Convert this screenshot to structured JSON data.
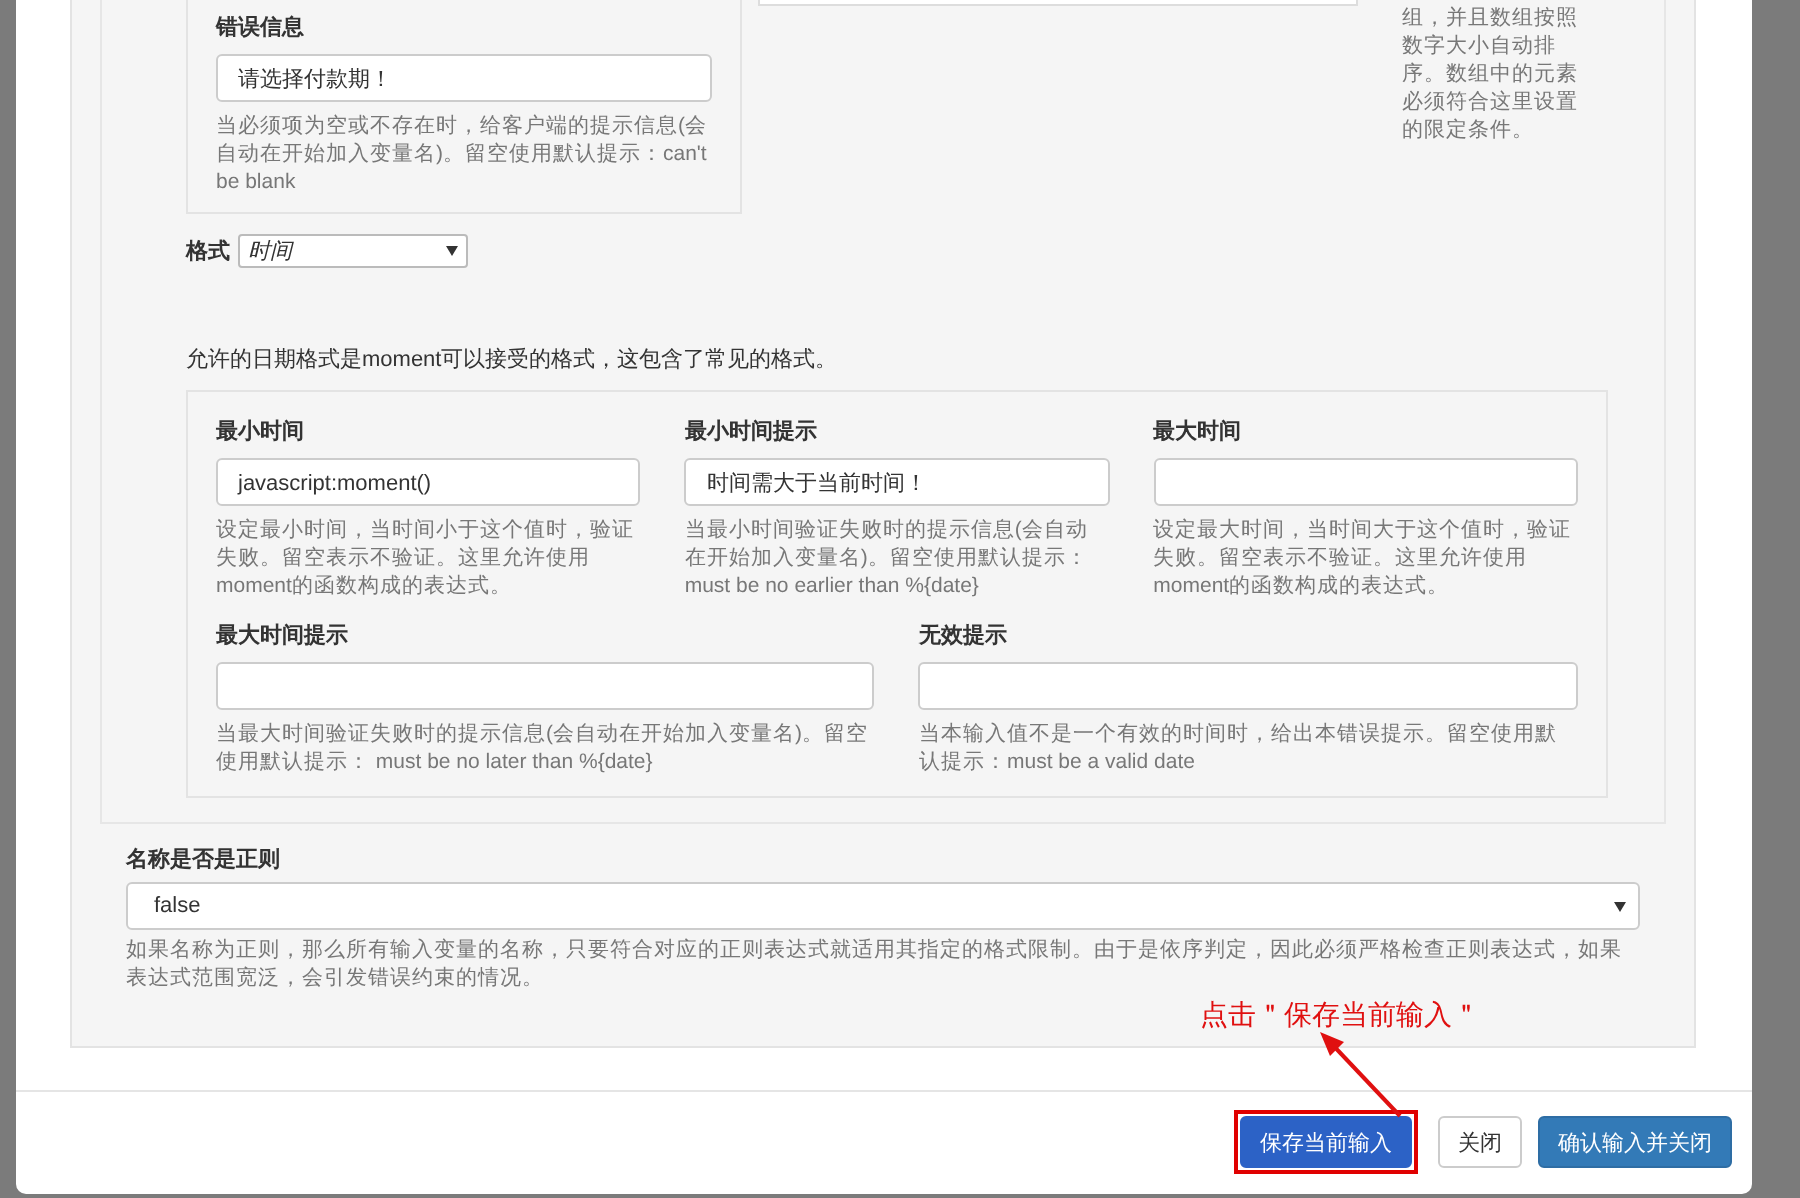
{
  "error_message": {
    "label": "错误信息",
    "value": "请选择付款期！",
    "help": "当必须项为空或不存在时，给客户端的提示信息(会自动在开始加入变量名)。留空使用默认提示：can't be blank"
  },
  "side_help": "组，并且数组按照数字大小自动排序。数组中的元素必须符合这里设置的限定条件。",
  "format": {
    "label": "格式",
    "value": "时间"
  },
  "format_note": "允许的日期格式是moment可以接受的格式，这包含了常见的格式。",
  "date_fields": [
    {
      "label": "最小时间",
      "value": "javascript:moment()",
      "help": "设定最小时间，当时间小于这个值时，验证失败。留空表示不验证。这里允许使用moment的函数构成的表达式。"
    },
    {
      "label": "最小时间提示",
      "value": "时间需大于当前时间！",
      "help": "当最小时间验证失败时的提示信息(会自动在开始加入变量名)。留空使用默认提示： must be no earlier than %{date}"
    },
    {
      "label": "最大时间",
      "help": "设定最大时间，当时间大于这个值时，验证失败。留空表示不验证。这里允许使用moment的函数构成的表达式。"
    },
    {
      "label": "最大时间提示",
      "help": "当最大时间验证失败时的提示信息(会自动在开始加入变量名)。留空使用默认提示： must be no later than %{date}"
    },
    {
      "label": "无效提示",
      "help": "当本输入值不是一个有效的时间时，给出本错误提示。留空使用默认提示：must be a valid date"
    }
  ],
  "regex_name": {
    "label": "名称是否是正则",
    "value": "false",
    "help": "如果名称为正则，那么所有输入变量的名称，只要符合对应的正则表达式就适用其指定的格式限制。由于是依序判定，因此必须严格检查正则表达式，如果表达式范围宽泛，会引发错误约束的情况。"
  },
  "annotation": "点击＂保存当前输入＂",
  "buttons": [
    {
      "label": "保存当前输入",
      "kind": "primary",
      "highlighted": true
    },
    {
      "label": "关闭",
      "kind": "default",
      "highlighted": false
    },
    {
      "label": "确认输入并关闭",
      "kind": "primary",
      "highlighted": false
    }
  ]
}
